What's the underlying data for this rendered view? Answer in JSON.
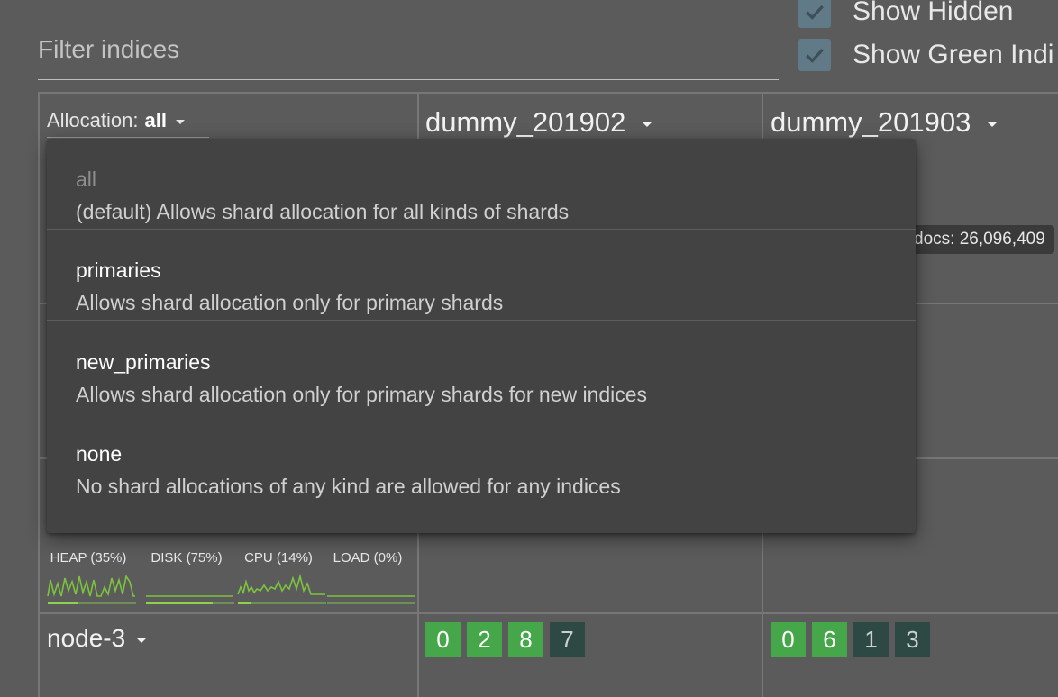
{
  "filter": {
    "placeholder": "Filter indices"
  },
  "checkboxes": [
    {
      "label": "Show Hidden",
      "checked": true
    },
    {
      "label": "Show Green Indi",
      "checked": true
    }
  ],
  "allocation": {
    "label": "Allocation:",
    "value": "all"
  },
  "indices": [
    {
      "name": "dummy_201902"
    },
    {
      "name": "dummy_201903"
    }
  ],
  "tooltip": "docs: 26,096,409",
  "allocation_menu": {
    "selected": "all",
    "items": [
      {
        "title": "all",
        "description": "(default) Allows shard allocation for all kinds of shards"
      },
      {
        "title": "primaries",
        "description": "Allows shard allocation only for primary shards"
      },
      {
        "title": "new_primaries",
        "description": "Allows shard allocation only for primary shards for new indices"
      },
      {
        "title": "none",
        "description": "No shard allocations of any kind are allowed for any indices"
      }
    ]
  },
  "metrics": [
    {
      "label": "HEAP (35%)",
      "value": 0.35
    },
    {
      "label": "DISK (75%)",
      "value": 0.75
    },
    {
      "label": "CPU (14%)",
      "value": 0.14
    },
    {
      "label": "LOAD (0%)",
      "value": 0.0
    }
  ],
  "node": {
    "name": "node-3",
    "shards": [
      [
        {
          "id": "0",
          "kind": "primary"
        },
        {
          "id": "2",
          "kind": "primary"
        },
        {
          "id": "8",
          "kind": "primary"
        },
        {
          "id": "7",
          "kind": "replica"
        }
      ],
      [
        {
          "id": "0",
          "kind": "primary"
        },
        {
          "id": "6",
          "kind": "primary"
        },
        {
          "id": "1",
          "kind": "replica"
        },
        {
          "id": "3",
          "kind": "replica"
        }
      ]
    ]
  },
  "colors": {
    "background": "#5b5b5b",
    "menu": "#434343",
    "primary_shard": "#45a749",
    "replica_shard": "#2e4943",
    "checkbox": "#617a88",
    "metric_line": "#7cc33f"
  }
}
